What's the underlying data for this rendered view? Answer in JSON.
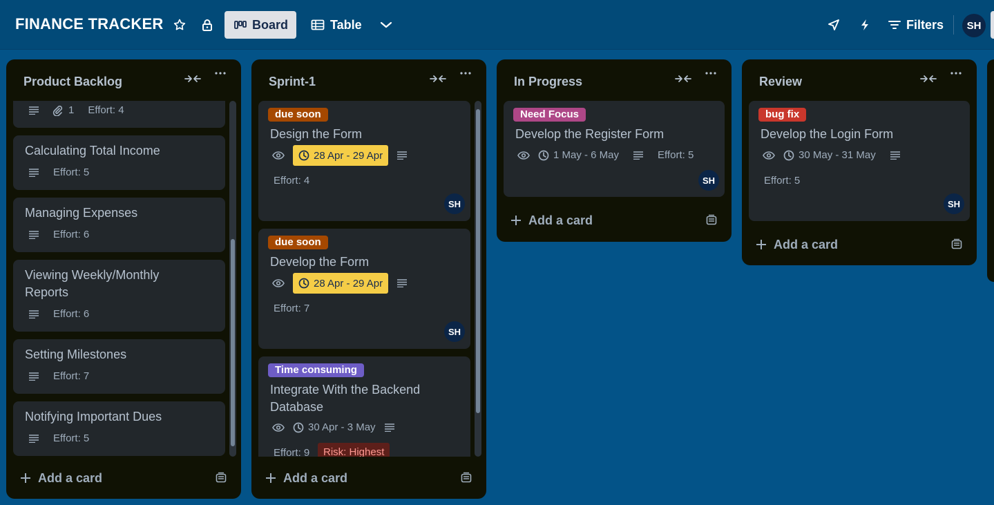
{
  "header": {
    "board_title": "FINANCE TRACKER",
    "views": [
      {
        "label": "Board"
      },
      {
        "label": "Table"
      }
    ],
    "filters_label": "Filters",
    "avatar_initials": "SH"
  },
  "lists": [
    {
      "title": "Product Backlog",
      "add_card_label": "Add a card",
      "cards": [
        {
          "title": "",
          "attachments": "1",
          "effort": "Effort: 4"
        },
        {
          "title": "Calculating Total Income",
          "effort": "Effort: 5"
        },
        {
          "title": "Managing Expenses",
          "effort": "Effort: 6"
        },
        {
          "title_line1": "Viewing Weekly/Monthly",
          "title_line2": "Reports",
          "effort": "Effort: 6"
        },
        {
          "title": "Setting Milestones",
          "effort": "Effort: 7"
        },
        {
          "title": "Notifying Important Dues",
          "effort": "Effort: 5"
        }
      ]
    },
    {
      "title": "Sprint-1",
      "add_card_label": "Add a card",
      "cards": [
        {
          "label": "due soon",
          "label_color": "#a54800",
          "title": "Design the Form",
          "due": "28 Apr - 29 Apr",
          "effort": "Effort: 4",
          "member": "SH"
        },
        {
          "label": "due soon",
          "label_color": "#a54800",
          "title": "Develop the Form",
          "due": "28 Apr - 29 Apr",
          "effort": "Effort: 7",
          "member": "SH"
        },
        {
          "label": "Time consuming",
          "label_color": "#6e5dc6",
          "title_line1": "Integrate With the Backend",
          "title_line2": "Database",
          "due": "30 Apr - 3 May",
          "effort": "Effort: 9",
          "risk": "Risk: Highest"
        }
      ]
    },
    {
      "title": "In Progress",
      "add_card_label": "Add a card",
      "cards": [
        {
          "label": "Need Focus",
          "label_color": "#ae4787",
          "title": "Develop the Register Form",
          "due": "1 May - 6 May",
          "effort": "Effort: 5",
          "member": "SH"
        }
      ]
    },
    {
      "title": "Review",
      "add_card_label": "Add a card",
      "cards": [
        {
          "label": "bug fix",
          "label_color": "#c9372c",
          "title": "Develop the Login Form",
          "due": "30 May - 31 May",
          "effort": "Effort: 5",
          "member": "SH"
        }
      ]
    }
  ],
  "colors": {
    "background": "#035388",
    "list_bg": "#101204",
    "card_bg": "#22272b",
    "due_soon_badge": "#f5cd47"
  }
}
